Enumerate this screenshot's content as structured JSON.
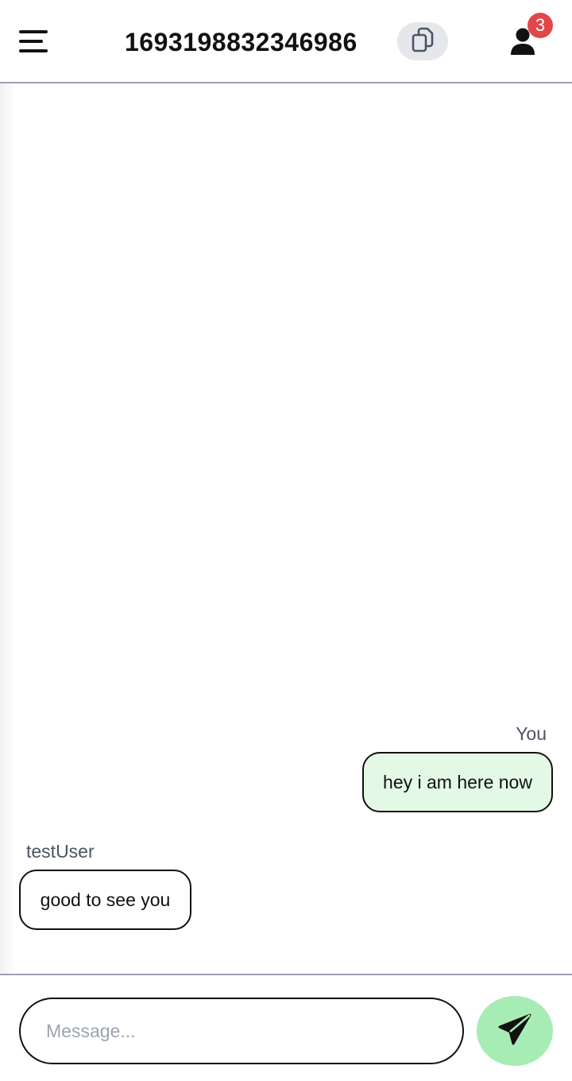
{
  "header": {
    "room_id": "1693198832346986",
    "user_badge_count": "3",
    "icons": {
      "menu": "menu-icon",
      "copy": "copy-icon",
      "user": "user-icon"
    }
  },
  "messages": [
    {
      "sender": "You",
      "text": "hey i am here now",
      "own": true
    },
    {
      "sender": "testUser",
      "text": "good to see you",
      "own": false
    }
  ],
  "composer": {
    "placeholder": "Message...",
    "value": "",
    "send_icon": "send-icon"
  },
  "colors": {
    "own_bubble": "#e3f9e5",
    "send_button": "#a7ecb4",
    "badge": "#e0484a",
    "copy_button": "#e5e7eb"
  }
}
